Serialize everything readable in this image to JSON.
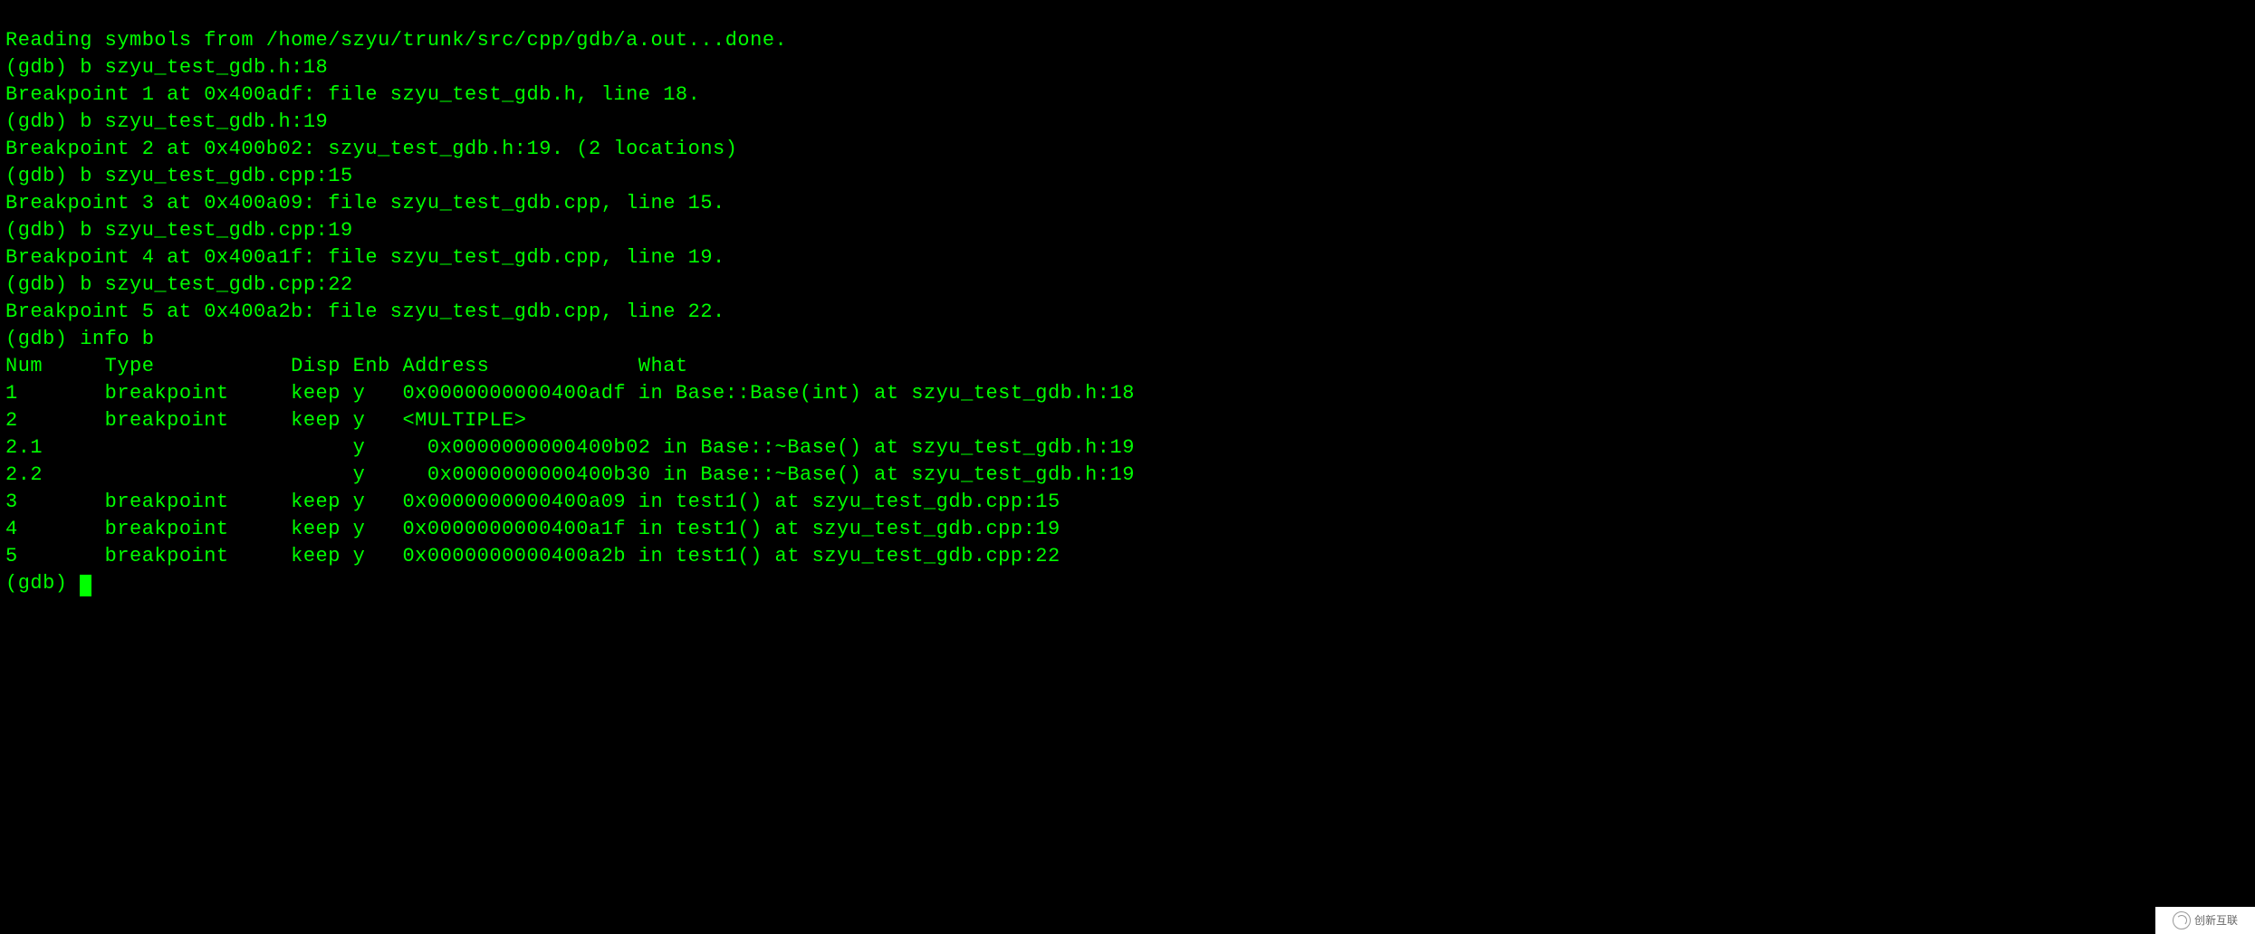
{
  "lines": {
    "l0": "Reading symbols from /home/szyu/trunk/src/cpp/gdb/a.out...done.",
    "l1": "(gdb) b szyu_test_gdb.h:18",
    "l2": "Breakpoint 1 at 0x400adf: file szyu_test_gdb.h, line 18.",
    "l3": "(gdb) b szyu_test_gdb.h:19",
    "l4": "Breakpoint 2 at 0x400b02: szyu_test_gdb.h:19. (2 locations)",
    "l5": "(gdb) b szyu_test_gdb.cpp:15",
    "l6": "Breakpoint 3 at 0x400a09: file szyu_test_gdb.cpp, line 15.",
    "l7": "(gdb) b szyu_test_gdb.cpp:19",
    "l8": "Breakpoint 4 at 0x400a1f: file szyu_test_gdb.cpp, line 19.",
    "l9": "(gdb) b szyu_test_gdb.cpp:22",
    "l10": "Breakpoint 5 at 0x400a2b: file szyu_test_gdb.cpp, line 22.",
    "l11": "(gdb) info b",
    "l12": "Num     Type           Disp Enb Address            What",
    "l13": "1       breakpoint     keep y   0x0000000000400adf in Base::Base(int) at szyu_test_gdb.h:18",
    "l14": "2       breakpoint     keep y   <MULTIPLE>         ",
    "l15": "2.1                         y     0x0000000000400b02 in Base::~Base() at szyu_test_gdb.h:19",
    "l16": "2.2                         y     0x0000000000400b30 in Base::~Base() at szyu_test_gdb.h:19",
    "l17": "3       breakpoint     keep y   0x0000000000400a09 in test1() at szyu_test_gdb.cpp:15",
    "l18": "4       breakpoint     keep y   0x0000000000400a1f in test1() at szyu_test_gdb.cpp:19",
    "l19": "5       breakpoint     keep y   0x0000000000400a2b in test1() at szyu_test_gdb.cpp:22",
    "l20": "(gdb) "
  },
  "watermark": {
    "text": "创新互联"
  }
}
